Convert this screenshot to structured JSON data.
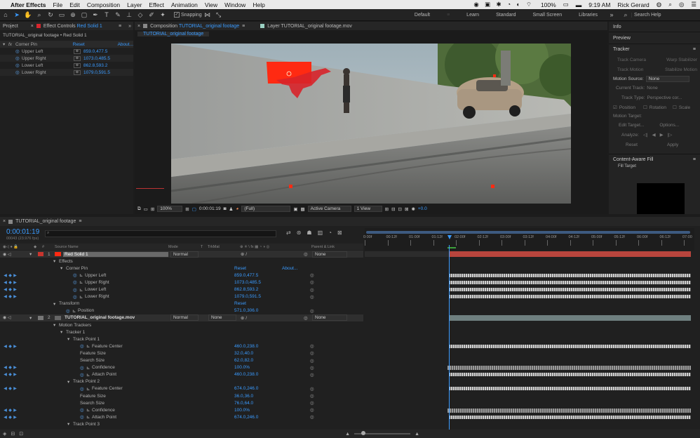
{
  "menubar": {
    "apple": "",
    "app": "After Effects",
    "items": [
      "File",
      "Edit",
      "Composition",
      "Layer",
      "Effect",
      "Animation",
      "View",
      "Window",
      "Help"
    ],
    "battery": "100%",
    "time": "9:19 AM",
    "user": "Rick Gerard"
  },
  "toolbar": {
    "snapping": "Snapping",
    "workspaces": [
      "Default",
      "Learn",
      "Standard",
      "Small Screen",
      "Libraries"
    ],
    "search": "Search Help"
  },
  "project_tab": "Project",
  "effect_controls": {
    "tab": "Effect Controls",
    "layer": "Red Solid 1",
    "header": "TUTORIAL_original footage • Red Solid 1",
    "effect": "Corner Pin",
    "reset": "Reset",
    "about": "About...",
    "props": [
      {
        "label": "Upper Left",
        "value": "859.0,477.5"
      },
      {
        "label": "Upper Right",
        "value": "1073.0,485.5"
      },
      {
        "label": "Lower Left",
        "value": "862.8,593.2"
      },
      {
        "label": "Lower Right",
        "value": "1079.0,591.5"
      }
    ]
  },
  "viewer": {
    "comp_tab_prefix": "Composition",
    "comp_name": "TUTORIAL_original footage",
    "footage_tab": "Layer TUTORIAL_original footage.mov",
    "sub_tab": "TUTORIAL_original footage",
    "zoom": "100%",
    "time": "0:00:01:19",
    "resolution": "(Full)",
    "camera": "Active Camera",
    "views": "1 View",
    "exposure": "+0.0"
  },
  "right": {
    "info": "Info",
    "preview": "Preview",
    "tracker": "Tracker",
    "track_camera": "Track Camera",
    "warp_stabilizer": "Warp Stabilizer",
    "track_motion": "Track Motion",
    "stabilize_motion": "Stabilize Motion",
    "motion_source_label": "Motion Source:",
    "motion_source": "None",
    "current_track_label": "Current Track:",
    "current_track": "None",
    "track_type_label": "Track Type:",
    "track_type": "Perspective cor...",
    "position": "Position",
    "rotation": "Rotation",
    "scale": "Scale",
    "motion_target": "Motion Target:",
    "edit_target": "Edit Target...",
    "options": "Options...",
    "analyze": "Analyze:",
    "reset": "Reset",
    "apply": "Apply",
    "caf": "Content-Aware Fill",
    "fill_target": "Fill Target"
  },
  "timeline": {
    "tab": "TUTORIAL_original footage",
    "timecode": "0:00:01:19",
    "frames": "00043 (23.976 fps)",
    "search_placeholder": "",
    "col_headers": {
      "num": "#",
      "source": "Source Name",
      "mode": "Mode",
      "t": "T",
      "trkmat": "TrkMat",
      "parent": "Parent & Link"
    },
    "ruler": [
      "0:00f",
      "00:12f",
      "01:00f",
      "01:12f",
      "02:00f",
      "02:12f",
      "03:00f",
      "03:12f",
      "04:00f",
      "04:12f",
      "05:00f",
      "05:12f",
      "06:00f",
      "06:12f",
      "07:00"
    ],
    "rows": [
      {
        "indent": 0,
        "num": "1",
        "label": "Red Solid 1",
        "mode": "Normal",
        "parent": "None",
        "value": "",
        "kind": "layer1"
      },
      {
        "indent": 1,
        "label": "Effects",
        "value": ""
      },
      {
        "indent": 2,
        "label": "Corner Pin",
        "value": "Reset",
        "extra": "About...",
        "fx": "fx"
      },
      {
        "indent": 3,
        "label": "Upper Left",
        "value": "859.0,477.5",
        "keys": true
      },
      {
        "indent": 3,
        "label": "Upper Right",
        "value": "1073.0,485.5",
        "keys": true
      },
      {
        "indent": 3,
        "label": "Lower Left",
        "value": "862.8,593.2",
        "keys": true
      },
      {
        "indent": 3,
        "label": "Lower Right",
        "value": "1079.0,591.5",
        "keys": true
      },
      {
        "indent": 1,
        "label": "Transform",
        "value": "Reset"
      },
      {
        "indent": 2,
        "label": "Position",
        "value": "571.0,306.0",
        "keys": false
      },
      {
        "indent": 0,
        "num": "2",
        "label": "TUTORIAL_original footage.mov",
        "mode": "Normal",
        "trkmat": "None",
        "parent": "None",
        "value": "",
        "kind": "layer2"
      },
      {
        "indent": 1,
        "label": "Motion Trackers",
        "value": ""
      },
      {
        "indent": 2,
        "label": "Tracker 1",
        "value": ""
      },
      {
        "indent": 3,
        "label": "Track Point 1",
        "value": ""
      },
      {
        "indent": 4,
        "label": "Feature Center",
        "value": "460.0,238.0",
        "keys": true
      },
      {
        "indent": 4,
        "label": "Feature Size",
        "value": "32.0,40.0"
      },
      {
        "indent": 4,
        "label": "Search Size",
        "value": "62.0,82.0"
      },
      {
        "indent": 4,
        "label": "Confidence",
        "value": "100.0%",
        "keys": true
      },
      {
        "indent": 4,
        "label": "Attach Point",
        "value": "460.0,238.0",
        "keys": true
      },
      {
        "indent": 3,
        "label": "Track Point 2",
        "value": ""
      },
      {
        "indent": 4,
        "label": "Feature Center",
        "value": "674.0,246.0",
        "keys": true
      },
      {
        "indent": 4,
        "label": "Feature Size",
        "value": "36.0,36.0"
      },
      {
        "indent": 4,
        "label": "Search Size",
        "value": "76.0,64.0"
      },
      {
        "indent": 4,
        "label": "Confidence",
        "value": "100.0%",
        "keys": true
      },
      {
        "indent": 4,
        "label": "Attach Point",
        "value": "674.0,246.0",
        "keys": true
      },
      {
        "indent": 3,
        "label": "Track Point 3",
        "value": ""
      }
    ]
  },
  "colors": {
    "accent": "#3a9bff",
    "red_solid": "#ff2a12",
    "playhead": "#3a9bff"
  }
}
